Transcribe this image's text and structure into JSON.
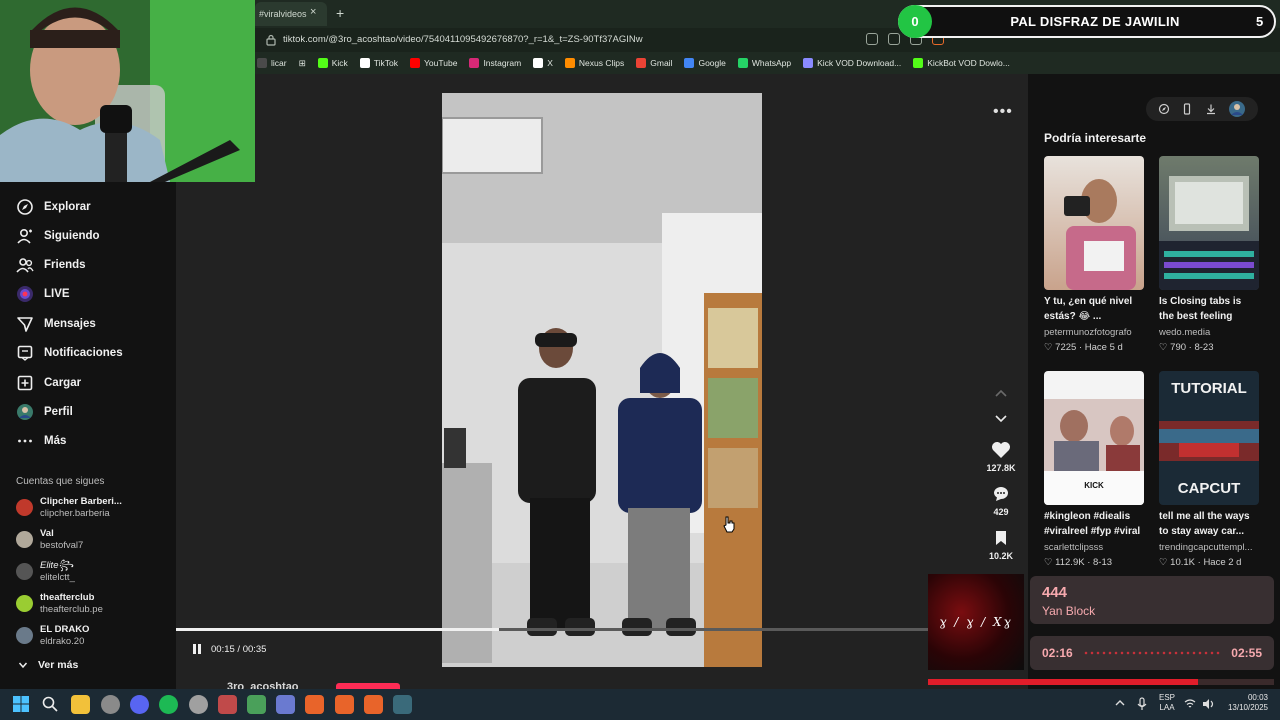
{
  "browser": {
    "active_tab_title": "#viralvideos",
    "close_tab_glyph": "×",
    "new_tab_glyph": "+",
    "url": "tiktok.com/@3ro_acoshtao/video/7540411095492676870?_r=1&_t=ZS-90Tf37AGINw",
    "bookmarks": [
      {
        "label": "licar",
        "color": "#4a4a4a"
      },
      {
        "label": "Kick",
        "color": "#53fc18"
      },
      {
        "label": "TikTok",
        "color": "#ffffff"
      },
      {
        "label": "YouTube",
        "color": "#ff0000"
      },
      {
        "label": "Instagram",
        "color": "#d62976"
      },
      {
        "label": "X",
        "color": "#ffffff"
      },
      {
        "label": "Nexus Clips",
        "color": "#ff8c00"
      },
      {
        "label": "Gmail",
        "color": "#ea4335"
      },
      {
        "label": "Google",
        "color": "#4285f4"
      },
      {
        "label": "WhatsApp",
        "color": "#25d366"
      },
      {
        "label": "Kick VOD Download...",
        "color": "#8a8aff"
      },
      {
        "label": "KickBot VOD Dowlo...",
        "color": "#53fc18"
      }
    ]
  },
  "goal_overlay": {
    "left_count": "0",
    "title": "PAL DISFRAZ DE JAWILIN",
    "right_count": "5",
    "accent": "#22c544"
  },
  "sidebar": {
    "nav": [
      {
        "label": "Explorar",
        "icon": "compass-icon"
      },
      {
        "label": "Siguiendo",
        "icon": "following-icon"
      },
      {
        "label": "Friends",
        "icon": "friends-icon"
      },
      {
        "label": "LIVE",
        "icon": "live-icon"
      },
      {
        "label": "Mensajes",
        "icon": "messages-icon"
      },
      {
        "label": "Notificaciones",
        "icon": "notifications-icon"
      },
      {
        "label": "Cargar",
        "icon": "upload-icon"
      },
      {
        "label": "Perfil",
        "icon": "profile-icon"
      },
      {
        "label": "Más",
        "icon": "more-icon"
      }
    ],
    "following_title": "Cuentas que sigues",
    "accounts": [
      {
        "name": "Clipcher Barberi...",
        "handle": "clipcher.barberia",
        "color": "#c0392b"
      },
      {
        "name": "Val",
        "handle": "bestofval7",
        "color": "#b0a89a"
      },
      {
        "name": "Elite꧂",
        "handle": "elitelctt_",
        "color": "#555555"
      },
      {
        "name": "theafterclub",
        "handle": "theafterclub.pe",
        "color": "#9acd32"
      },
      {
        "name": "EL DRAKO",
        "handle": "eldrako.20",
        "color": "#6a7a8a"
      }
    ],
    "see_more": "Ver más"
  },
  "video": {
    "current_time": "00:15",
    "duration": "00:35",
    "time_display": "00:15 / 00:35",
    "progress": 0.43,
    "author": "3ro_acoshtao",
    "more_glyph": "•••",
    "likes": "127.8K",
    "comments": "429",
    "saves": "10.2K"
  },
  "right_panel": {
    "title": "Podría interesarte",
    "cards": [
      {
        "title": "Y tu, ¿en qué nivel estás? 😂 ...",
        "author": "petermunozfotografo",
        "likes": "7225",
        "date": "Hace 5 d",
        "colors": [
          "#c9a38c",
          "#e8e2dc"
        ],
        "overlay": ""
      },
      {
        "title": "Is Closing tabs is the best feeling after...",
        "author": "wedo.media",
        "likes": "790",
        "date": "8-23",
        "colors": [
          "#3a4456",
          "#6f7b6c"
        ],
        "overlay": ""
      },
      {
        "title": "#kingleon #diealis #viralreel #fyp #viral",
        "author": "scarlettclipsss",
        "likes": "112.9K",
        "date": "8-13",
        "colors": [
          "#f4f4f4",
          "#d8c6c2"
        ],
        "overlay": "KICK"
      },
      {
        "title": "tell me all the ways to stay away car...",
        "author": "trendingcapcuttempl...",
        "likes": "10.1K",
        "date": "Hace 2 d",
        "colors": [
          "#1b2a36",
          "#7a2a2a"
        ],
        "overlay_top": "TUTORIAL",
        "overlay": "CAPCUT"
      }
    ]
  },
  "music": {
    "track": "444",
    "artist": "Yan Block",
    "elapsed": "02:16",
    "total": "02:55",
    "progress": 0.78,
    "art_text": "ɣ / ɣ / Xɣ",
    "accent": "#e11d2a"
  },
  "taskbar": {
    "lang_top": "ESP",
    "lang_bottom": "LAA",
    "time": "00:03",
    "date": "13/10/2025"
  }
}
